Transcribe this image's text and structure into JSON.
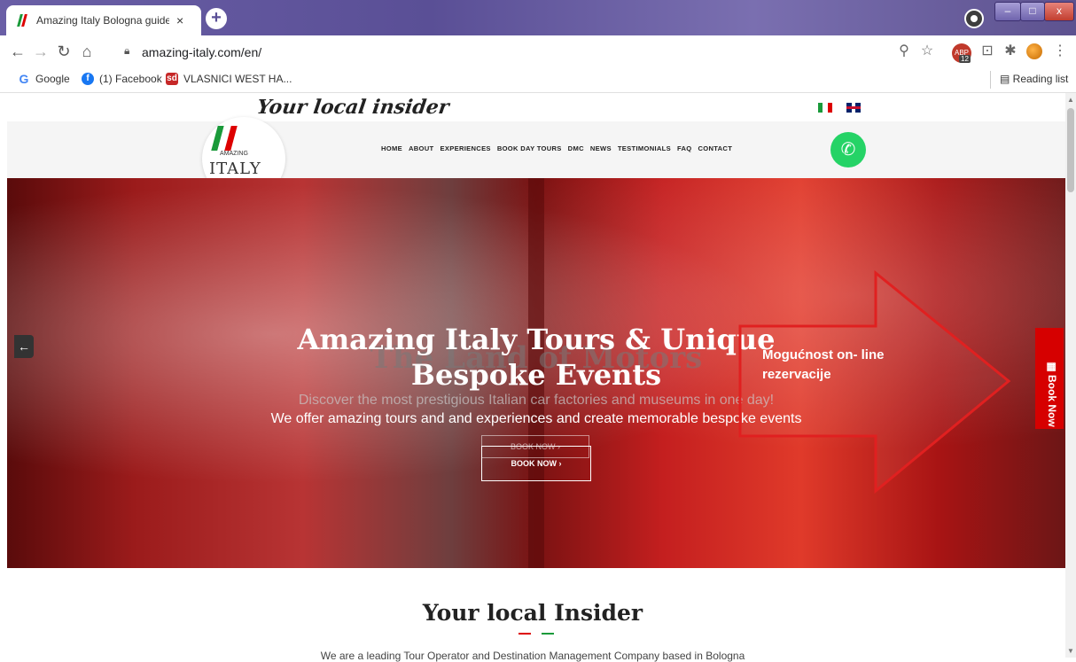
{
  "browser": {
    "tab_title": "Amazing Italy Bologna guided to",
    "tab_close": "×",
    "new_tab": "+",
    "url": "amazing-italy.com/en/",
    "bookmarks": [
      {
        "label": "Google"
      },
      {
        "label": "(1) Facebook"
      },
      {
        "label": "VLASNICI WEST HA..."
      }
    ],
    "reading_list": "Reading list",
    "extension_badge": "12"
  },
  "site": {
    "tagline": "Your local insider",
    "logo_text": "ITALY",
    "logo_small": "AMAZING",
    "menu": [
      "HOME",
      "ABOUT",
      "EXPERIENCES",
      "BOOK DAY TOURS",
      "DMC",
      "NEWS",
      "TESTIMONIALS",
      "FAQ",
      "CONTACT"
    ],
    "colors": {
      "accent_red": "#d60000",
      "whatsapp": "#25d366"
    }
  },
  "hero": {
    "title_line1": "Amazing Italy Tours & Unique",
    "title_line2": "Bespoke Events",
    "ghost_title": "The Land of Motors",
    "ghost_subtitle": "Discover the most prestigious Italian car factories and museums in one day!",
    "subtitle": "We offer amazing tours and and experiences and create memorable bespoke events",
    "ghost_button": "BOOK NOW  ›",
    "button": "BOOK NOW  ›"
  },
  "annotation": {
    "line1": "Mogućnost on- line",
    "line2": "rezervacije"
  },
  "side_button": {
    "label": "Book Now"
  },
  "section": {
    "title": "Your local Insider",
    "intro": "We are a leading Tour Operator and Destination Management Company based in Bologna"
  }
}
